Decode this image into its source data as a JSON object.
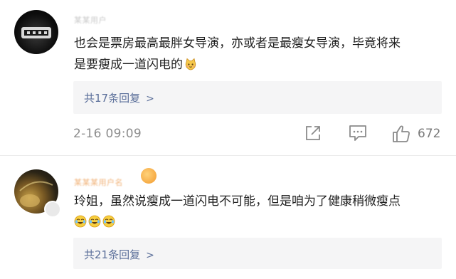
{
  "comments": [
    {
      "username": "某某用户",
      "text_line1": "也会是票房最高最胖女导演，亦或者是最瘦女导演，毕竟将来",
      "text_line2": "是要瘦成一道闪电的",
      "replies_label": "共17条回复",
      "timestamp": "2-16 09:09",
      "likes": "672",
      "emoji": "cat-face-icon"
    },
    {
      "username": "某某某用户名",
      "text_line1": "玲姐，虽然说瘦成一道闪电不可能，但是咱为了健康稍微瘦点",
      "replies_label": "共21条回复",
      "emoji": "laugh-cry-icon"
    }
  ],
  "colors": {
    "link": "#5b6f9a",
    "meta": "#8d8d8d",
    "reply_bg": "#f5f5f6"
  }
}
